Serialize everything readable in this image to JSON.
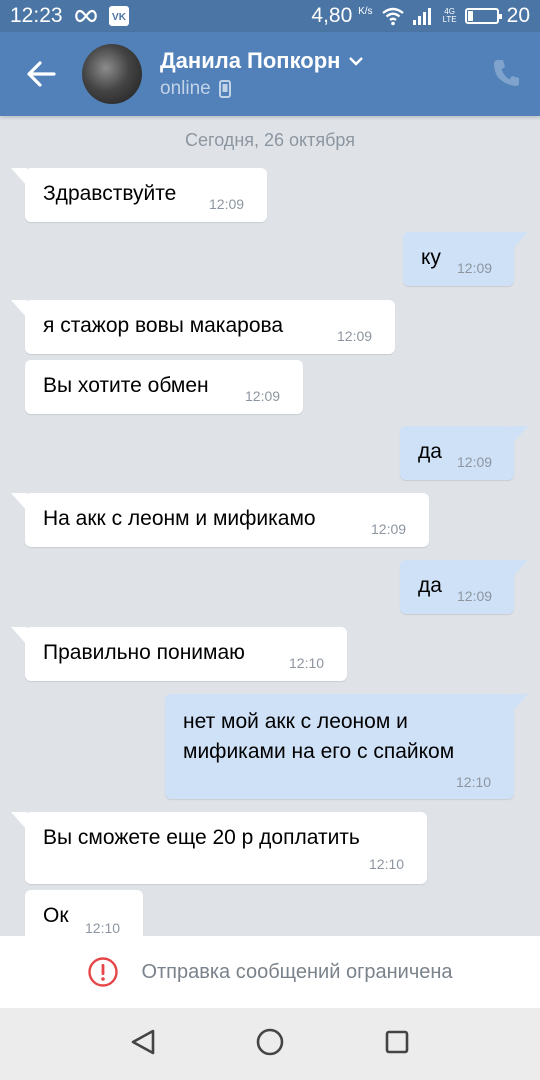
{
  "status_bar": {
    "time": "12:23",
    "speed": "4,80",
    "speed_unit": "K/s",
    "network": "4G",
    "lte": "LTE",
    "battery": "20",
    "battery_level": 0.2
  },
  "header": {
    "name": "Данила Попкорн",
    "status": "online"
  },
  "chat": {
    "date": "Сегодня, 26 октября",
    "messages": [
      {
        "dir": "in",
        "text": "Здравствуйте",
        "time": "12:09"
      },
      {
        "dir": "out",
        "text": "ку",
        "time": "12:09"
      },
      {
        "dir": "in",
        "text": "я стажор вовы макарова",
        "time": "12:09"
      },
      {
        "dir": "in",
        "text": "Вы хотите обмен",
        "time": "12:09"
      },
      {
        "dir": "out",
        "text": "да",
        "time": "12:09"
      },
      {
        "dir": "in",
        "text": "На акк с леонм и мификамо",
        "time": "12:09"
      },
      {
        "dir": "out",
        "text": "да",
        "time": "12:09"
      },
      {
        "dir": "in",
        "text": "Правильно понимаю",
        "time": "12:10"
      },
      {
        "dir": "out",
        "text_line1": "нет мой акк с леоном и",
        "text_line2": "мификами на его с спайком",
        "time": "12:10"
      },
      {
        "dir": "in",
        "text": "Вы сможете еще 20 р доплатить",
        "time": "12:10"
      },
      {
        "dir": "in",
        "text": "Ок",
        "time": "12:10"
      }
    ]
  },
  "footer": {
    "restriction": "Отправка сообщений ограничена"
  },
  "colors": {
    "header": "#5181b8",
    "status_bar": "#4a75a4",
    "incoming": "#ffffff",
    "outgoing": "#cfe1f7",
    "background": "#dfe3e8",
    "alert": "#e64646"
  }
}
